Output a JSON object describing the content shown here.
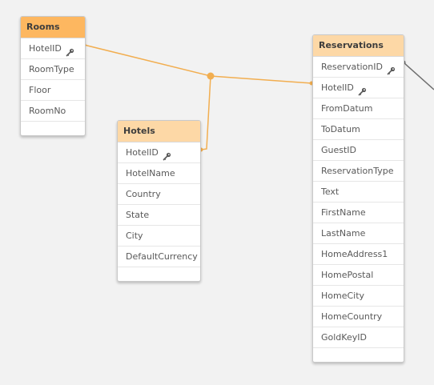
{
  "colors": {
    "background": "#f2f2f2",
    "link": "#f2ae50",
    "header_selected": "#fdb760",
    "header": "#fdd8a6",
    "key_icon": "#595959",
    "external_link": "#6e6e6e"
  },
  "icons": {
    "key": "key-icon"
  },
  "tables": [
    {
      "name": "Rooms",
      "selected": true,
      "fields": [
        {
          "label": "HotelID",
          "key": true
        },
        {
          "label": "RoomType",
          "key": false
        },
        {
          "label": "Floor",
          "key": false
        },
        {
          "label": "RoomNo",
          "key": false
        }
      ]
    },
    {
      "name": "Hotels",
      "selected": false,
      "fields": [
        {
          "label": "HotelID",
          "key": true
        },
        {
          "label": "HotelName",
          "key": false
        },
        {
          "label": "Country",
          "key": false
        },
        {
          "label": "State",
          "key": false
        },
        {
          "label": "City",
          "key": false
        },
        {
          "label": "DefaultCurrency",
          "key": false
        }
      ]
    },
    {
      "name": "Reservations",
      "selected": false,
      "fields": [
        {
          "label": "ReservationID",
          "key": true
        },
        {
          "label": "HotelID",
          "key": true
        },
        {
          "label": "FromDatum",
          "key": false
        },
        {
          "label": "ToDatum",
          "key": false
        },
        {
          "label": "GuestID",
          "key": false
        },
        {
          "label": "ReservationType",
          "key": false
        },
        {
          "label": "Text",
          "key": false
        },
        {
          "label": "FirstName",
          "key": false
        },
        {
          "label": "LastName",
          "key": false
        },
        {
          "label": "HomeAddress1",
          "key": false
        },
        {
          "label": "HomePostal",
          "key": false
        },
        {
          "label": "HomeCity",
          "key": false
        },
        {
          "label": "HomeCountry",
          "key": false
        },
        {
          "label": "GoldKeyID",
          "key": false
        }
      ]
    }
  ]
}
